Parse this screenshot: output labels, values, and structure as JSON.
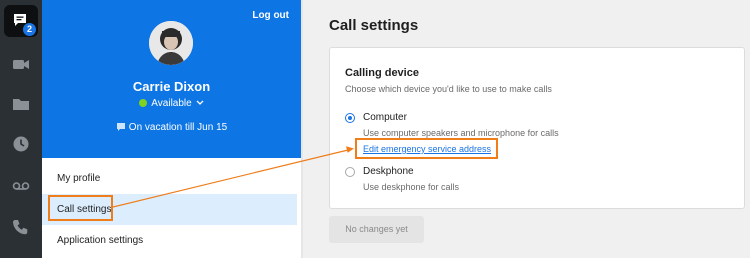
{
  "rail": {
    "app_badge": "2",
    "icons": [
      "video-icon",
      "folder-icon",
      "clock-icon",
      "voicemail-icon",
      "call-settings-icon"
    ]
  },
  "profile": {
    "logout_label": "Log out",
    "name": "Carrie Dixon",
    "status": "Available",
    "vacation": "On vacation till Jun 15"
  },
  "menu": {
    "items": [
      {
        "label": "My profile"
      },
      {
        "label": "Call settings"
      },
      {
        "label": "Application settings"
      }
    ],
    "active_index": 1
  },
  "main": {
    "title": "Call settings",
    "card": {
      "title": "Calling device",
      "subtitle": "Choose which device you'd like to use to make calls",
      "options": [
        {
          "label": "Computer",
          "description": "Use computer speakers and microphone for calls",
          "selected": true
        },
        {
          "label": "Deskphone",
          "description": "Use deskphone for calls",
          "selected": false
        }
      ],
      "link": "Edit emergency service address"
    },
    "button_label": "No changes yet"
  },
  "colors": {
    "accent": "#1b74e4",
    "header_blue": "#0d75e4",
    "highlight_orange": "#ef7d1a",
    "available_green": "#7ed321",
    "rail_dark": "#2b3035"
  }
}
